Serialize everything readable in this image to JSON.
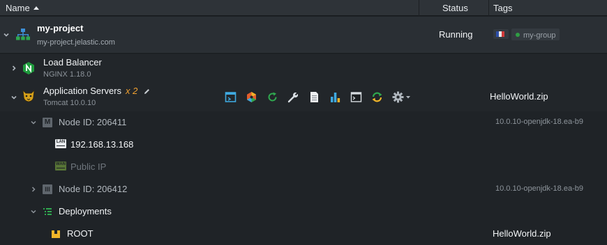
{
  "header": {
    "name_label": "Name",
    "status_label": "Status",
    "tags_label": "Tags",
    "sort_icon": "sort-asc-icon"
  },
  "environment": {
    "name": "my-project",
    "domain": "my-project.jelastic.com",
    "status": "Running",
    "region_flag": "flag-france-icon",
    "group_tag": "my-group",
    "group_dot_color": "#2f9e44"
  },
  "load_balancer": {
    "name": "Load Balancer",
    "version": "NGINX 1.18.0",
    "icon": "nginx-icon",
    "icon_color": "#1f9b3d"
  },
  "app_servers": {
    "name": "Application Servers",
    "multiplier": "x 2",
    "version": "Tomcat 10.0.10",
    "deployment": "HelloWorld.zip",
    "icon": "tomcat-icon",
    "toolbar": [
      {
        "name": "open-in-browser-button",
        "icon": "open-in-browser-icon"
      },
      {
        "name": "add-ons-button",
        "icon": "add-ons-icon"
      },
      {
        "name": "restart-button",
        "icon": "restart-icon"
      },
      {
        "name": "config-button",
        "icon": "wrench-icon"
      },
      {
        "name": "log-button",
        "icon": "log-file-icon"
      },
      {
        "name": "statistics-button",
        "icon": "statistics-icon"
      },
      {
        "name": "web-ssh-button",
        "icon": "terminal-icon"
      },
      {
        "name": "redeploy-button",
        "icon": "redeploy-icon"
      },
      {
        "name": "settings-button",
        "icon": "gear-icon"
      }
    ]
  },
  "nodes": [
    {
      "label": "Node ID: 206411",
      "version": "10.0.10-openjdk-18.ea-b9",
      "badge": "M"
    },
    {
      "label": "Node ID: 206412",
      "version": "10.0.10-openjdk-18.ea-b9",
      "badge": "III"
    }
  ],
  "ips": {
    "private_ip": "192.168.13.168",
    "private_badge": "LAN",
    "public_ip": "Public IP",
    "public_badge": "WAN"
  },
  "deployments": {
    "label": "Deployments",
    "items": [
      {
        "name": "ROOT",
        "file": "HelloWorld.zip"
      }
    ]
  }
}
